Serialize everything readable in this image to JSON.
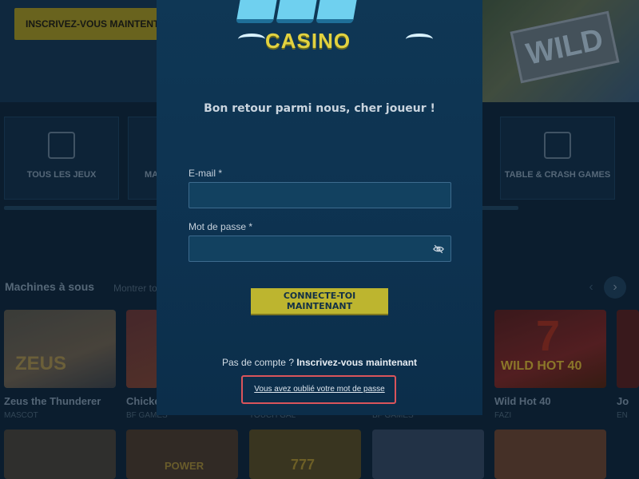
{
  "background": {
    "cta_label": "INSCRIVEZ-VOUS MAINTENT",
    "banner_text": "WILD",
    "categories": [
      "TOUS LES JEUX",
      "MA",
      "TABLE & CRASH GAMES"
    ],
    "section_title": "Machines à sous",
    "section_link": "Montrer to",
    "games": [
      {
        "name": "Zeus the Thunderer",
        "provider": "MASCOT",
        "art_text": "ZEUS"
      },
      {
        "name": "Chicke",
        "provider": "BF GAMES"
      },
      {
        "name": "",
        "provider": "TOUCH GAL"
      },
      {
        "name": "",
        "provider": "BF GAMES"
      },
      {
        "name": "Wild Hot 40",
        "provider": "FAZI",
        "art_text": "WILD HOT 40"
      },
      {
        "name": "Jo",
        "provider": "EN"
      }
    ],
    "row2_art_text": [
      "",
      "POWER",
      "777",
      "",
      ""
    ]
  },
  "modal": {
    "logo_text": "CASINO",
    "welcome": "Bon retour parmi nous, cher joueur !",
    "email_label": "E-mail *",
    "email_value": "",
    "password_label": "Mot de passe *",
    "password_value": "",
    "connect_button": "CONNECTE-TOI MAINTENANT",
    "signup_prompt": "Pas de compte ?",
    "signup_link": "Inscrivez-vous maintenant",
    "forgot_link": "Vous avez oublié votre mot de passe",
    "colors": {
      "accent": "#bdb52f",
      "highlight_box": "#d9545b",
      "modal_bg": "#0f3755"
    }
  }
}
